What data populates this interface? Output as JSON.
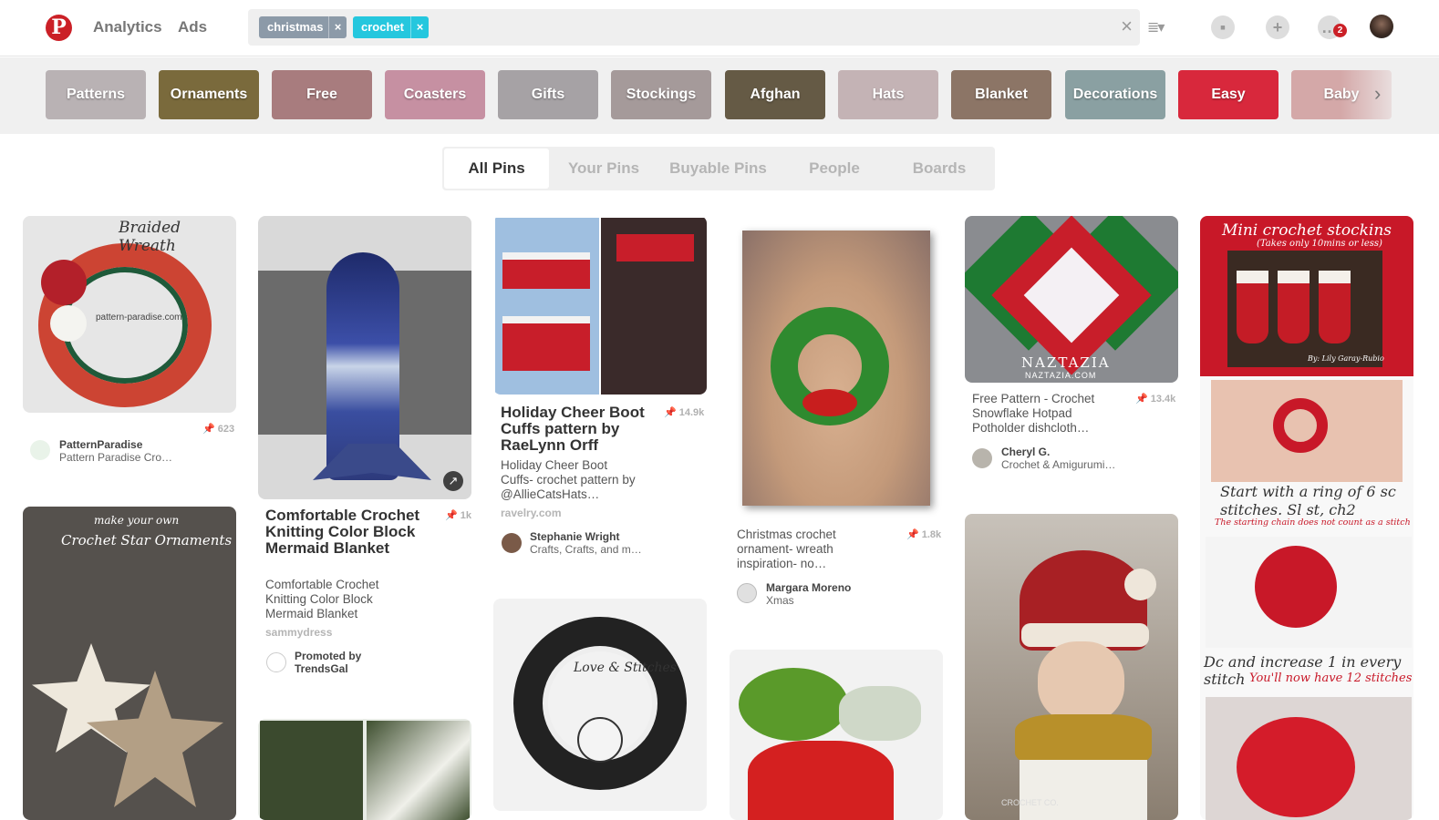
{
  "header": {
    "logo": "P",
    "nav": [
      "Analytics",
      "Ads"
    ],
    "search_chips": [
      {
        "label": "christmas",
        "remove": "×",
        "color": "#8c9aa8"
      },
      {
        "label": "crochet",
        "remove": "×",
        "color": "#25c7de"
      }
    ],
    "clear": "×",
    "list_icon": "≣▾",
    "badge_count": "2"
  },
  "guides": [
    {
      "label": "Patterns",
      "bg": "#b9b2b4"
    },
    {
      "label": "Ornaments",
      "bg": "#7a6a3c"
    },
    {
      "label": "Free",
      "bg": "#a87c7e"
    },
    {
      "label": "Coasters",
      "bg": "#c690a2"
    },
    {
      "label": "Gifts",
      "bg": "#a6a2a5"
    },
    {
      "label": "Stockings",
      "bg": "#a59a9a"
    },
    {
      "label": "Afghan",
      "bg": "#655a45"
    },
    {
      "label": "Hats",
      "bg": "#c4b3b5"
    },
    {
      "label": "Blanket",
      "bg": "#8c7566"
    },
    {
      "label": "Decorations",
      "bg": "#8aa0a2"
    },
    {
      "label": "Easy",
      "bg": "#d8283c"
    },
    {
      "label": "Baby",
      "bg": "#d4a8a8"
    }
  ],
  "guide_arrow": "›",
  "filters": [
    "All Pins",
    "Your Pins",
    "Buyable Pins",
    "People",
    "Boards"
  ],
  "accent": "#cb2027",
  "pins": [
    {
      "overlay": "Braided Wreath",
      "watermark": "pattern-paradise.com",
      "saves": "📌 623",
      "user": "PatternParadise",
      "board": "Pattern Paradise Cro…"
    },
    {
      "title": "Comfortable Crochet Knitting Color Block Mermaid Blanket",
      "desc": "Comfortable Crochet Knitting Color Block Mermaid Blanket",
      "source": "sammydress",
      "saves": "📌 1k",
      "user": "Promoted by",
      "board": "TrendsGal",
      "expand": "↗"
    },
    {
      "title": "Holiday Cheer Boot Cuffs pattern by RaeLynn Orff",
      "desc": "Holiday Cheer Boot Cuffs- crochet pattern by @AllieCatsHats…",
      "source": "ravelry.com",
      "saves": "📌 14.9k",
      "user": "Stephanie Wright",
      "board": "Crafts, Crafts, and m…"
    },
    {
      "desc": "Christmas crochet ornament- wreath inspiration- no…",
      "saves": "📌 1.8k",
      "user": "Margara Moreno",
      "board": "Xmas"
    },
    {
      "desc": "Free Pattern - Crochet Snowflake Hotpad Potholder dishcloth…",
      "saves": "📌 13.4k",
      "user": "Cheryl G.",
      "board": "Crochet & Amigurumi…",
      "overlay": "NAZTAZIA",
      "overlay2": "NAZTAZIA.COM"
    },
    {
      "overlay": "Mini crochet stockins",
      "overlay_sub": "(Takes only 10mins or less)",
      "credit": "By: Lily Garay-Rubio",
      "step1": "Start with a ring of 6 sc stitches. Sl st, ch2",
      "step1_note": "The starting chain does not count as a stitch",
      "step2": "Dc and increase 1 in every stitch",
      "step2_note": "You'll now have 12 stitches"
    },
    {
      "overlay": "make your own",
      "overlay2": "Crochet Star Ornaments"
    },
    {
      "overlay": "Love & Stitches"
    },
    {
      "overlay": "CROCHET CO."
    }
  ]
}
